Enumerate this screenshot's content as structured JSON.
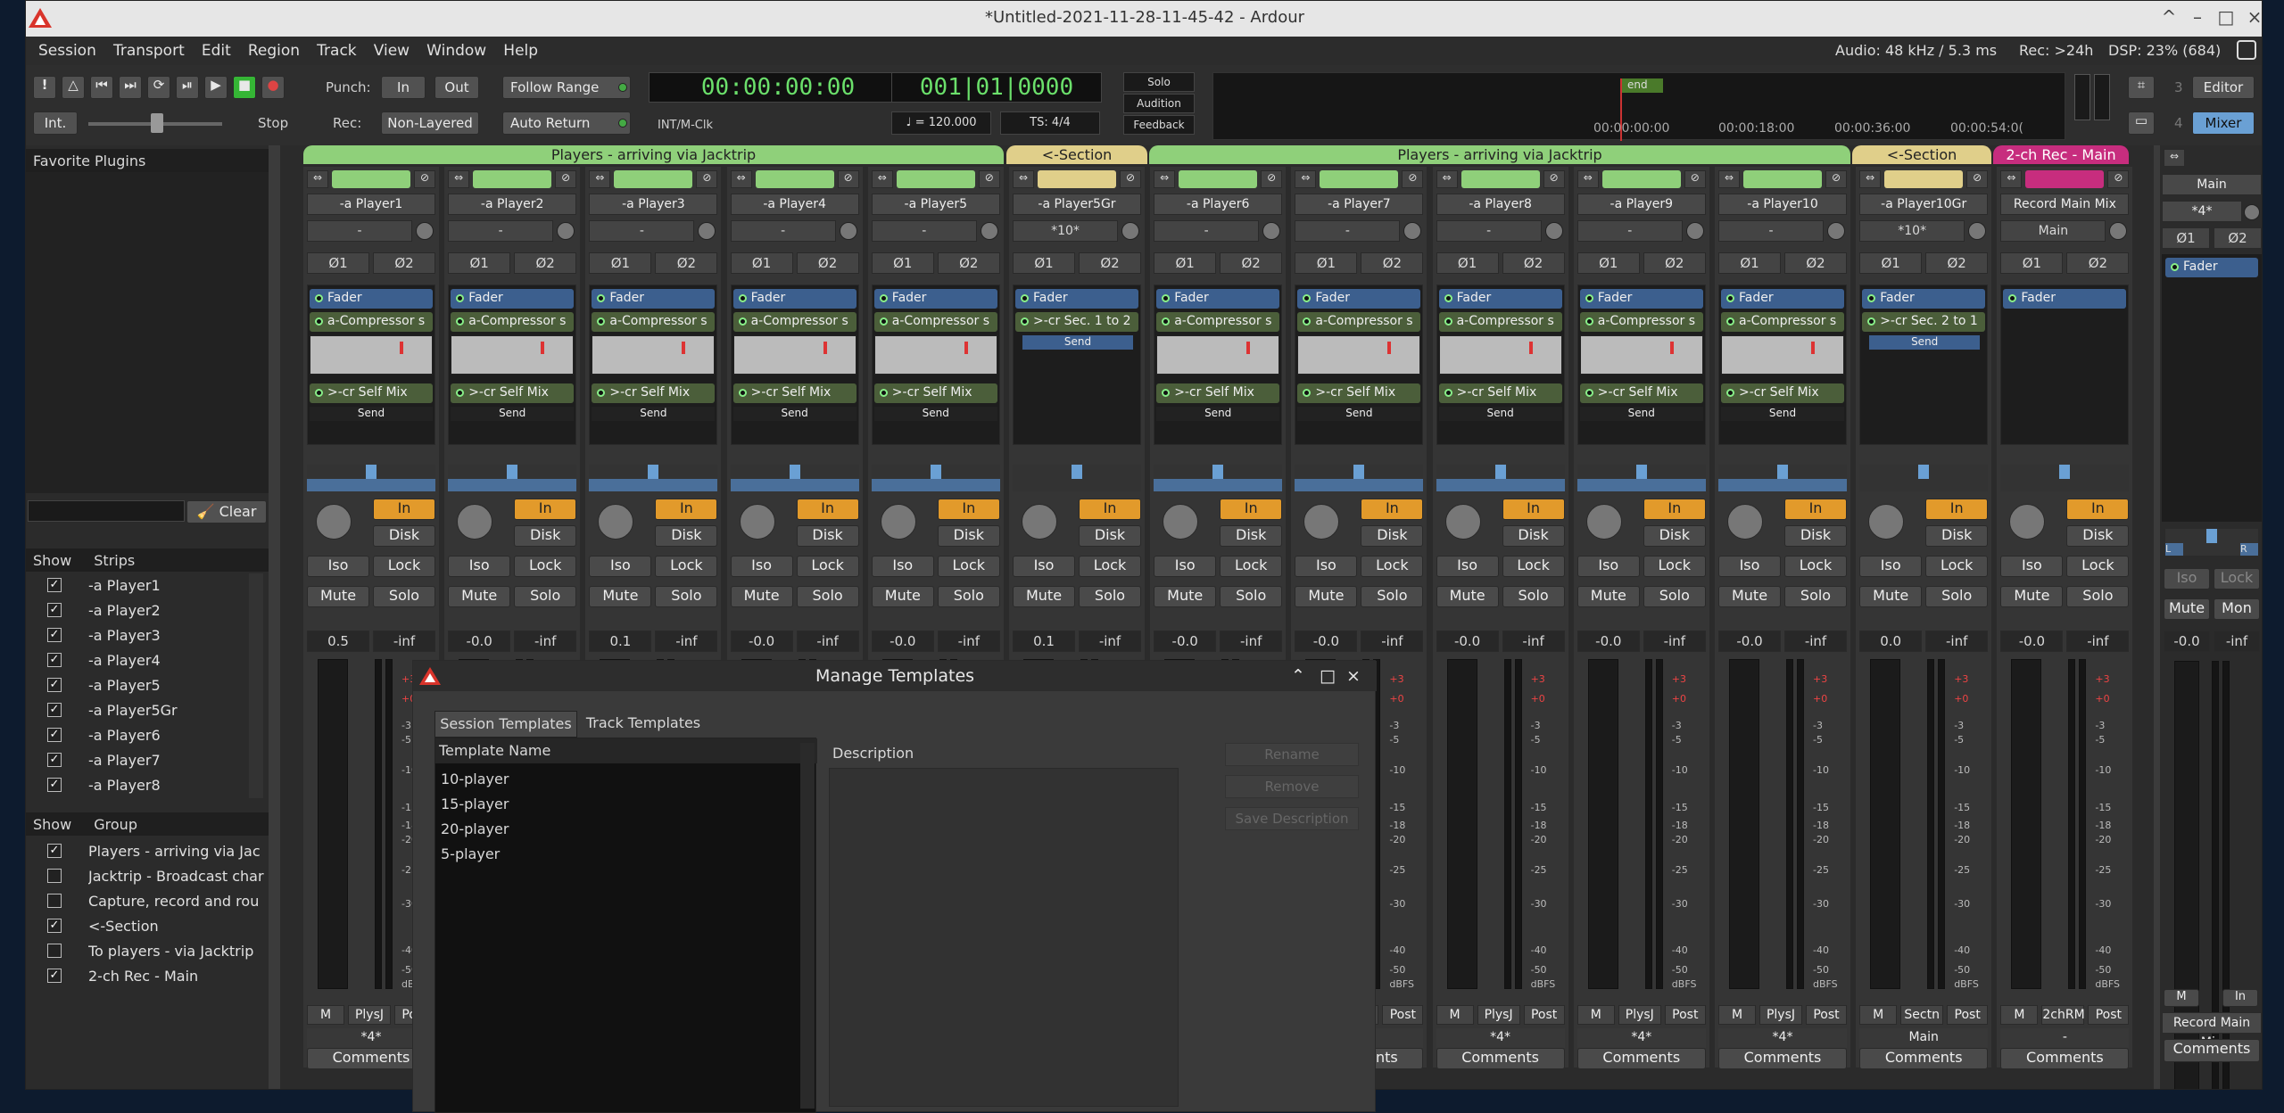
{
  "window": {
    "title": "*Untitled-2021-11-28-11-45-42 - Ardour",
    "controls": [
      "^",
      "–",
      "□",
      "×"
    ]
  },
  "menu": {
    "items": [
      "Session",
      "Transport",
      "Edit",
      "Region",
      "Track",
      "View",
      "Window",
      "Help"
    ],
    "status": {
      "audio": "Audio: 48 kHz / 5.3 ms",
      "rec": "Rec: >24h",
      "dsp": "DSP: 23% (684)"
    }
  },
  "toolbar": {
    "int_label": "Int.",
    "stop_label": "Stop",
    "punch_label": "Punch:",
    "punch_in": "In",
    "punch_out": "Out",
    "rec_label": "Rec:",
    "rec_mode": "Non-Layered",
    "follow_range": "Follow Range",
    "auto_return": "Auto Return",
    "timecode": "00:00:00:00",
    "clock_source": "INT/M-Clk",
    "bbt": "001|01|0000",
    "tempo": "♩ = 120.000",
    "ts": "TS: 4/4",
    "solo": "Solo",
    "audition": "Audition",
    "feedback": "Feedback",
    "mini_end": "end",
    "mini_times": [
      "00:00:00:00",
      "00:00:18:00",
      "00:00:36:00",
      "00:00:54:0("
    ],
    "editor": "Editor",
    "mixer": "Mixer",
    "num3": "3",
    "num4": "4"
  },
  "sidebar": {
    "favorites_title": "Favorite Plugins",
    "clear_label": "Clear",
    "strips_header_show": "Show",
    "strips_header_label": "Strips",
    "strips": [
      "-a Player1",
      "-a Player2",
      "-a Player3",
      "-a Player4",
      "-a Player5",
      "-a Player5Gr",
      "-a Player6",
      "-a Player7",
      "-a Player8"
    ],
    "group_header_show": "Show",
    "group_header_label": "Group",
    "groups": [
      {
        "name": "Players - arriving via Jac",
        "checked": true
      },
      {
        "name": "Jacktrip - Broadcast char",
        "checked": false
      },
      {
        "name": "Capture, record and rou",
        "checked": false
      },
      {
        "name": "<-Section",
        "checked": true
      },
      {
        "name": "To players - via Jacktrip",
        "checked": false
      },
      {
        "name": "2-ch Rec - Main",
        "checked": true
      }
    ]
  },
  "mixer": {
    "groups": [
      {
        "name": "Players - arriving via Jacktrip",
        "color": "#8fd07a"
      },
      {
        "name": "<-Section",
        "color": "#e0cf8a"
      },
      {
        "name": "Players - arriving via Jacktrip",
        "color": "#8fd07a"
      },
      {
        "name": "<-Section",
        "color": "#e0cf8a"
      },
      {
        "name": "2-ch Rec - Main",
        "color": "#c72d7e"
      }
    ],
    "strip_common": {
      "phase1": "Ø1",
      "phase2": "Ø2",
      "fader": "Fader",
      "compressor": "a-Compressor s",
      "selfmix": ">-cr Self Mix",
      "send": "Send",
      "in": "In",
      "disk": "Disk",
      "iso": "Iso",
      "lock": "Lock",
      "mute": "Mute",
      "solo": "Solo",
      "gain_inf": "-inf",
      "meter_m": "M",
      "post": "Post",
      "comments": "Comments",
      "scale": [
        "-3",
        "-5",
        "-10",
        "-15",
        "-18",
        "-20",
        "-25",
        "-30",
        "-40",
        "-50",
        "dBFS"
      ],
      "scale_top": [
        "+3",
        "+0"
      ]
    },
    "strips": [
      {
        "name": "-a Player1",
        "input": "-",
        "gain": "0.5",
        "color": "#8fd07a",
        "out": "PlysJ",
        "bottom": "*4*",
        "type": "player"
      },
      {
        "name": "-a Player2",
        "input": "-",
        "gain": "-0.0",
        "color": "#8fd07a",
        "out": "PlysJ",
        "bottom": "",
        "type": "player"
      },
      {
        "name": "-a Player3",
        "input": "-",
        "gain": "0.1",
        "color": "#8fd07a",
        "out": "PlysJ",
        "bottom": "",
        "type": "player"
      },
      {
        "name": "-a Player4",
        "input": "-",
        "gain": "-0.0",
        "color": "#8fd07a",
        "out": "PlysJ",
        "bottom": "",
        "type": "player"
      },
      {
        "name": "-a Player5",
        "input": "-",
        "gain": "-0.0",
        "color": "#8fd07a",
        "out": "PlysJ",
        "bottom": "",
        "type": "player"
      },
      {
        "name": "-a Player5Gr",
        "input": "*10*",
        "gain": "0.1",
        "color": "#e0cf8a",
        "out": "Sectn",
        "bottom": "",
        "type": "section",
        "sec": ">-cr Sec. 1 to 2"
      },
      {
        "name": "-a Player6",
        "input": "-",
        "gain": "-0.0",
        "color": "#8fd07a",
        "out": "PlysJ",
        "bottom": "",
        "type": "player"
      },
      {
        "name": "-a Player7",
        "input": "-",
        "gain": "-0.0",
        "color": "#8fd07a",
        "out": "PlysJ",
        "bottom": "",
        "type": "player"
      },
      {
        "name": "-a Player8",
        "input": "-",
        "gain": "-0.0",
        "color": "#8fd07a",
        "out": "PlysJ",
        "bottom": "*4*",
        "type": "player"
      },
      {
        "name": "-a Player9",
        "input": "-",
        "gain": "-0.0",
        "color": "#8fd07a",
        "out": "PlysJ",
        "bottom": "*4*",
        "type": "player"
      },
      {
        "name": "-a Player10",
        "input": "-",
        "gain": "-0.0",
        "color": "#8fd07a",
        "out": "PlysJ",
        "bottom": "*4*",
        "type": "player"
      },
      {
        "name": "-a Player10Gr",
        "input": "*10*",
        "gain": "0.0",
        "color": "#e0cf8a",
        "out": "Sectn",
        "bottom": "Main",
        "type": "section",
        "sec": ">-cr Sec. 2 to 1"
      },
      {
        "name": "Record Main Mix",
        "input": "Main",
        "gain": "-0.0",
        "color": "#c72d7e",
        "out": "2chRM",
        "bottom": "-",
        "type": "record"
      }
    ],
    "master": {
      "label": "Main",
      "input": "*4*",
      "fader": "Fader",
      "iso": "Iso",
      "lock": "Lock",
      "mute": "Mute",
      "mon": "Mon",
      "gain": "-0.0",
      "gain2": "-inf",
      "m": "M",
      "in": "In",
      "name": "Record Main Mix",
      "comments": "Comments"
    }
  },
  "dialog": {
    "title": "Manage Templates",
    "tabs": [
      "Session Templates",
      "Track Templates"
    ],
    "col_name": "Template Name",
    "col_desc": "Description",
    "templates": [
      "10-player",
      "15-player",
      "20-player",
      "5-player"
    ],
    "rename": "Rename",
    "remove": "Remove",
    "save_desc": "Save Description"
  }
}
